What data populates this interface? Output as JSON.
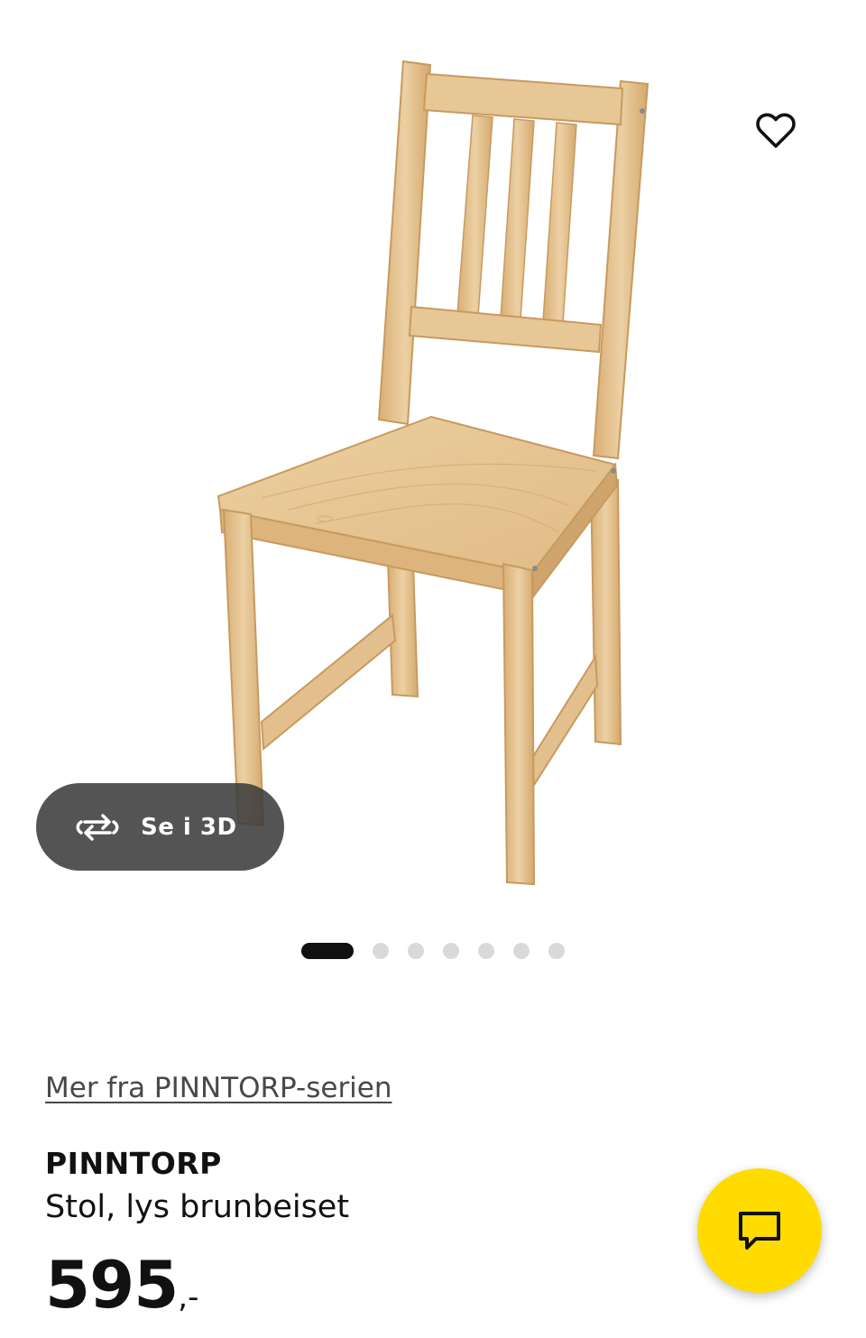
{
  "gallery": {
    "image_alt": "PINNTORP chair",
    "view3d_label": "Se i 3D",
    "slide_count": 7,
    "active_slide": 1
  },
  "product": {
    "series_link": "Mer fra PINNTORP-serien",
    "name": "PINNTORP",
    "description": "Stol, lys brunbeiset",
    "price_amount": "595",
    "price_suffix": ",-"
  },
  "icons": {
    "favorite": "heart-outline-icon",
    "view3d": "rotate-3d-icon",
    "chat": "chat-bubble-icon"
  },
  "colors": {
    "accent_yellow": "#ffdb00",
    "wood_light": "#e9c99a",
    "wood_mid": "#dcb47c",
    "wood_dark": "#c79a5f",
    "overlay_dark": "#3c3c3c"
  }
}
